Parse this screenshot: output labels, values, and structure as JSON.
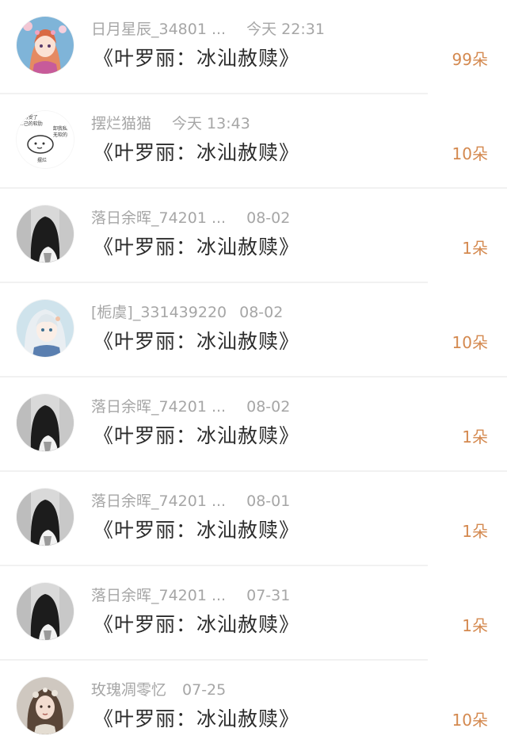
{
  "rows": [
    {
      "user": "日月星辰_34801 ...",
      "time": "今天 22:31",
      "title": "《叶罗丽：冰汕赦赎》",
      "flowers": "99朵",
      "avatar": "anime-girl-pink"
    },
    {
      "user": "摆烂猫猫",
      "time": "今天 13:43",
      "title": "《叶罗丽：冰汕赦赎》",
      "flowers": "10朵",
      "avatar": "meme-sticker",
      "avatar_text": [
        "...得受了",
        "...己的软肋",
        "卸我私",
        "无软的",
        "摆烂"
      ]
    },
    {
      "user": "落日余晖_74201 ...",
      "time": "08-02",
      "title": "《叶罗丽：冰汕赦赎》",
      "flowers": "1朵",
      "avatar": "black-hair-girl"
    },
    {
      "user": "[栀虞]_331439220",
      "time": "08-02",
      "title": "《叶罗丽：冰汕赦赎》",
      "flowers": "10朵",
      "avatar": "anime-girl-white"
    },
    {
      "user": "落日余晖_74201 ...",
      "time": "08-02",
      "title": "《叶罗丽：冰汕赦赎》",
      "flowers": "1朵",
      "avatar": "black-hair-girl"
    },
    {
      "user": "落日余晖_74201 ...",
      "time": "08-01",
      "title": "《叶罗丽：冰汕赦赎》",
      "flowers": "1朵",
      "avatar": "black-hair-girl"
    },
    {
      "user": "落日余晖_74201 ...",
      "time": "07-31",
      "title": "《叶罗丽：冰汕赦赎》",
      "flowers": "1朵",
      "avatar": "black-hair-girl"
    },
    {
      "user": "玫瑰凋零忆",
      "time": "07-25",
      "title": "《叶罗丽：冰汕赦赎》",
      "flowers": "10朵",
      "avatar": "realistic-girl-flowers"
    }
  ],
  "colors": {
    "meta_gray": "#a6a6a6",
    "title_dark": "#2b2b2b",
    "flower_orange": "#d4894f",
    "divider": "#f1f1f1"
  }
}
